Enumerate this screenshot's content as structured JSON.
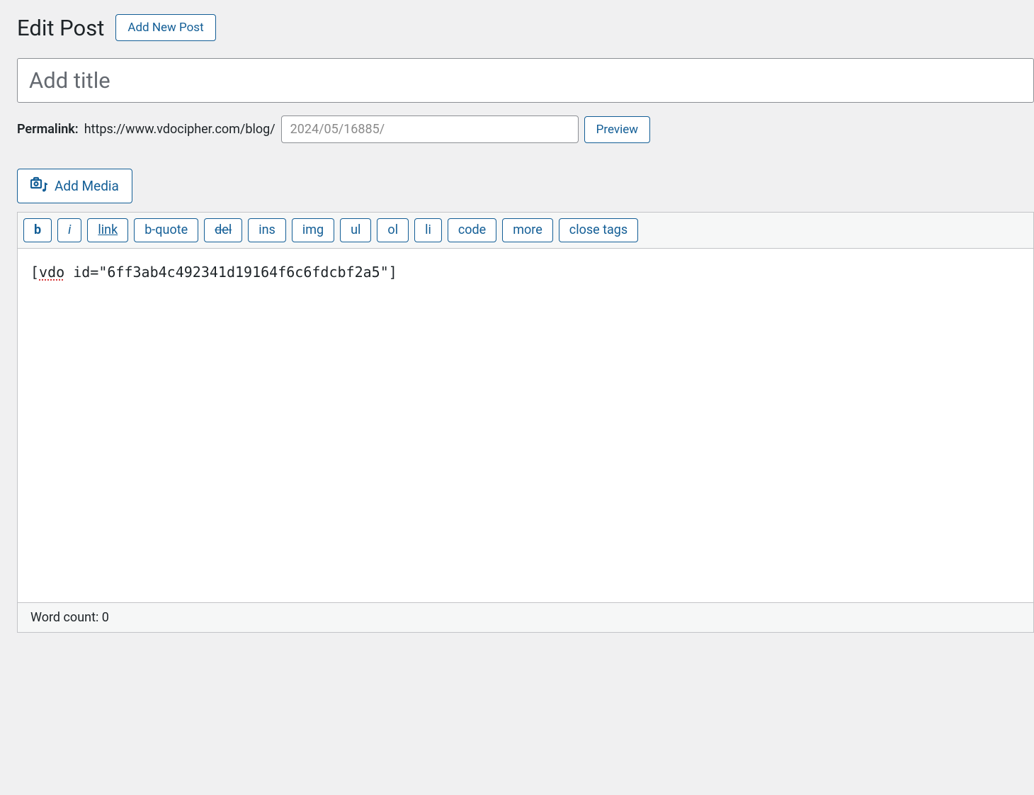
{
  "header": {
    "title": "Edit Post",
    "add_new_label": "Add New Post"
  },
  "title_input": {
    "value": "",
    "placeholder": "Add title"
  },
  "permalink": {
    "label": "Permalink:",
    "base_url": "https://www.vdocipher.com/blog/",
    "slug_value": "",
    "slug_placeholder": "2024/05/16885/",
    "preview_label": "Preview"
  },
  "media": {
    "add_media_label": "Add Media"
  },
  "quicktags": {
    "bold": "b",
    "italic": "i",
    "link": "link",
    "bquote": "b-quote",
    "del": "del",
    "ins": "ins",
    "img": "img",
    "ul": "ul",
    "ol": "ol",
    "li": "li",
    "code": "code",
    "more": "more",
    "close": "close tags"
  },
  "editor": {
    "content_prefix": "[",
    "content_spellerr": "vdo",
    "content_suffix": " id=\"6ff3ab4c492341d19164f6c6fdcbf2a5\"]"
  },
  "status": {
    "word_count_label": "Word count: ",
    "word_count_value": "0"
  }
}
